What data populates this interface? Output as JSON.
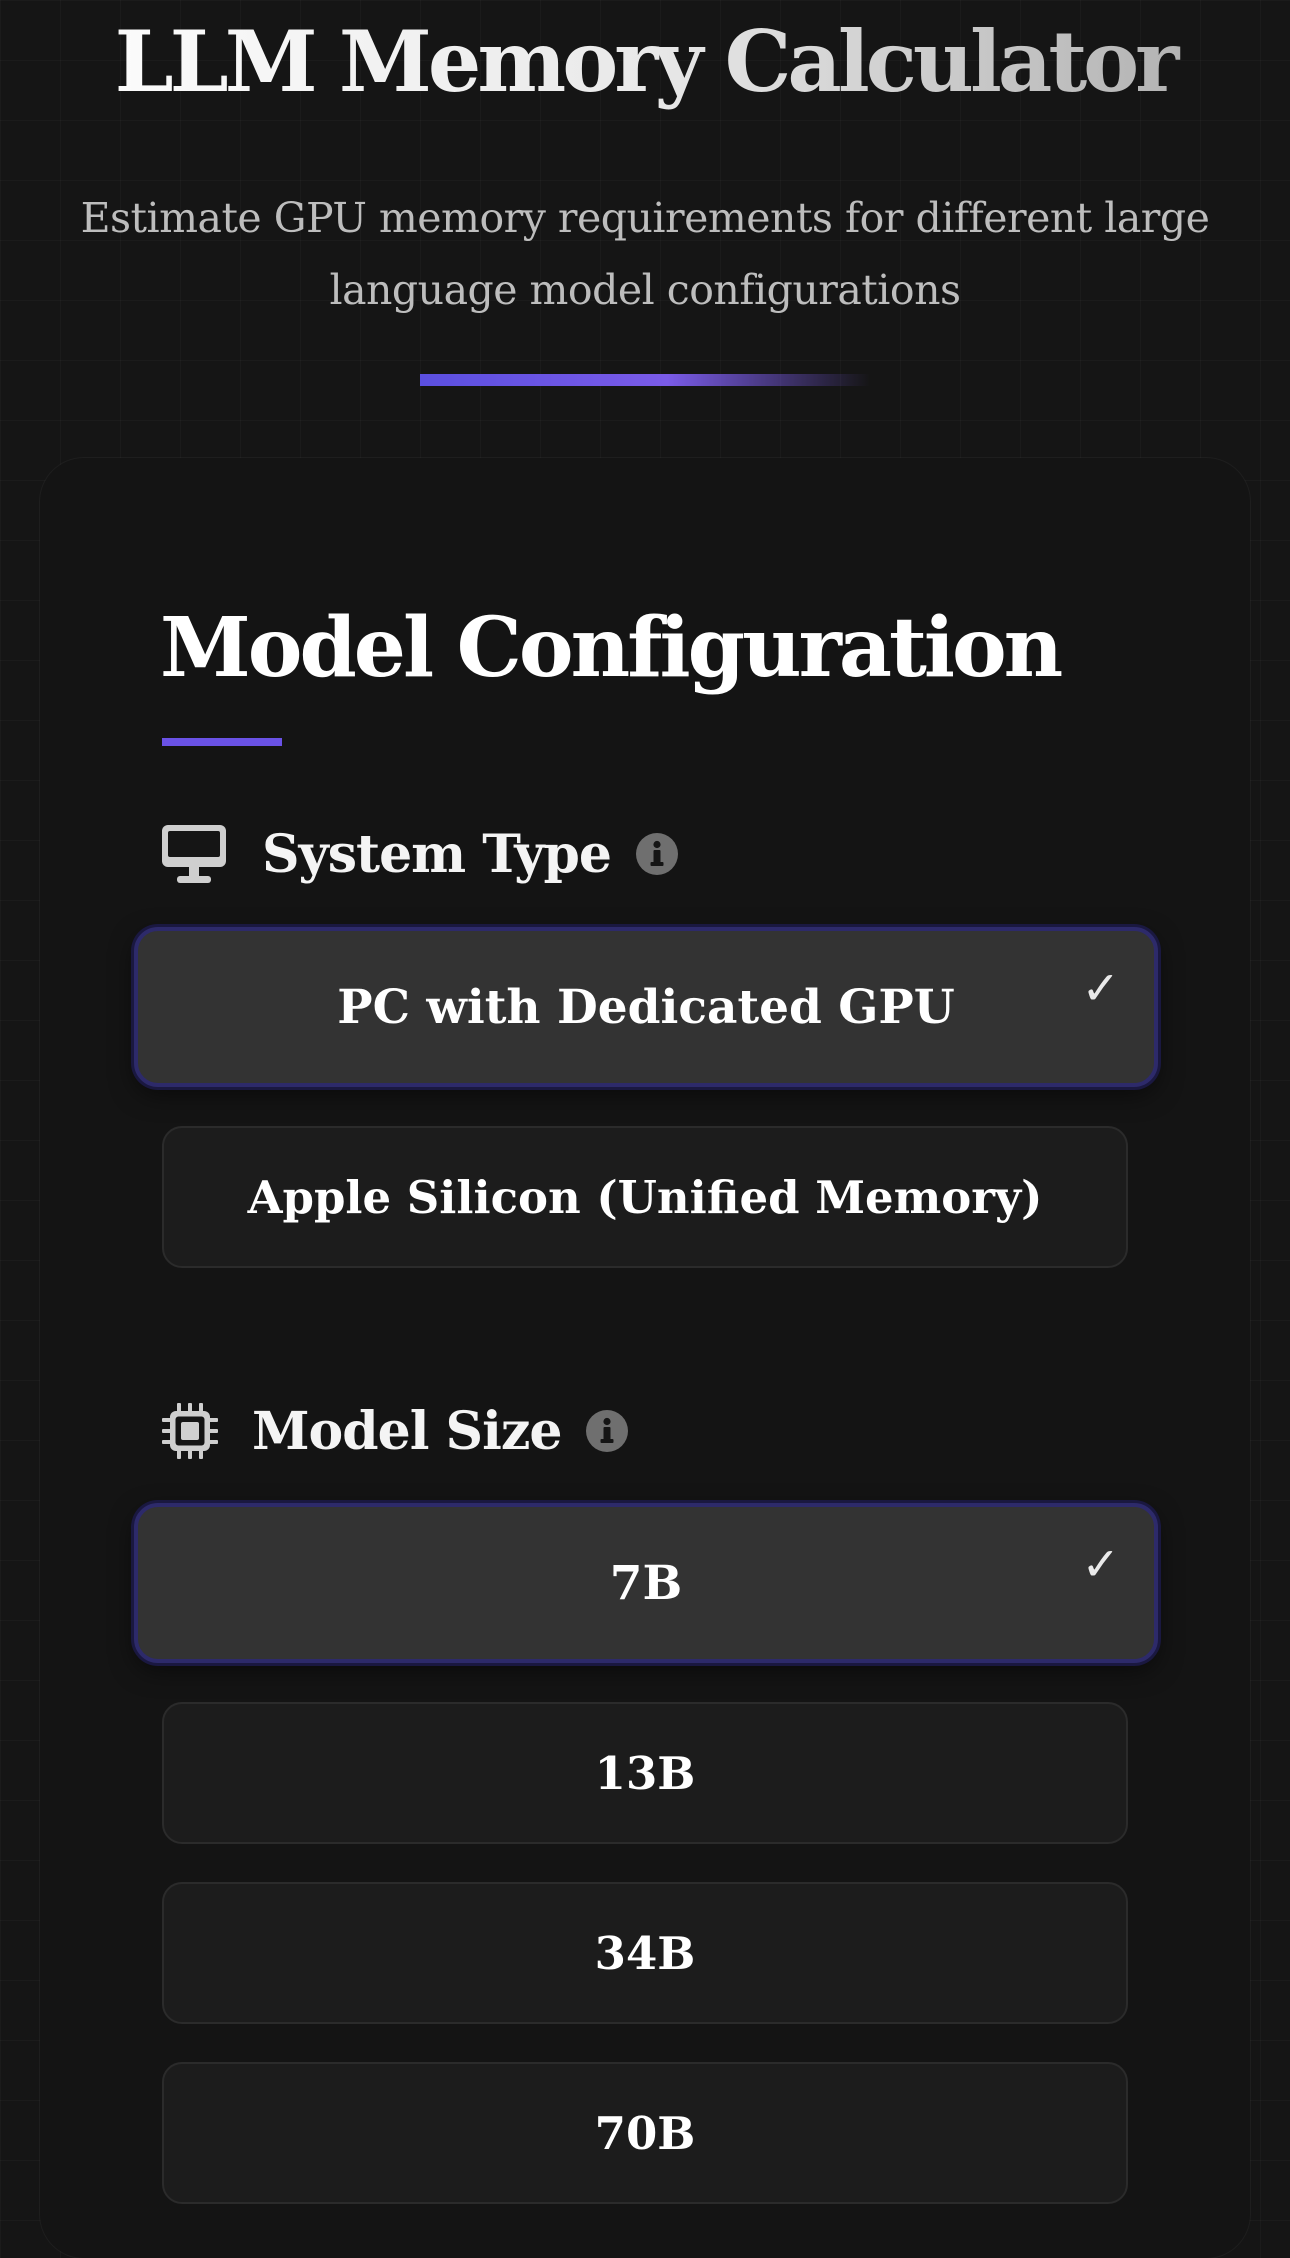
{
  "header": {
    "title": "LLM Memory Calculator",
    "subtitle": "Estimate GPU memory requirements for different large language model configurations"
  },
  "config": {
    "title": "Model Configuration",
    "system_type": {
      "label": "System Type",
      "icon": "monitor-icon",
      "info_icon": "info-icon",
      "options": [
        {
          "label": "PC with Dedicated GPU",
          "selected": true
        },
        {
          "label": "Apple Silicon (Unified Memory)",
          "selected": false
        }
      ]
    },
    "model_size": {
      "label": "Model Size",
      "icon": "chip-icon",
      "info_icon": "info-icon",
      "options": [
        {
          "label": "7B",
          "selected": true
        },
        {
          "label": "13B",
          "selected": false
        },
        {
          "label": "34B",
          "selected": false
        },
        {
          "label": "70B",
          "selected": false
        }
      ]
    },
    "check_mark": "✓"
  },
  "colors": {
    "accent": "#6a52e6",
    "background": "#151515",
    "selected_option": "#333333",
    "option": "#1c1c1c"
  }
}
